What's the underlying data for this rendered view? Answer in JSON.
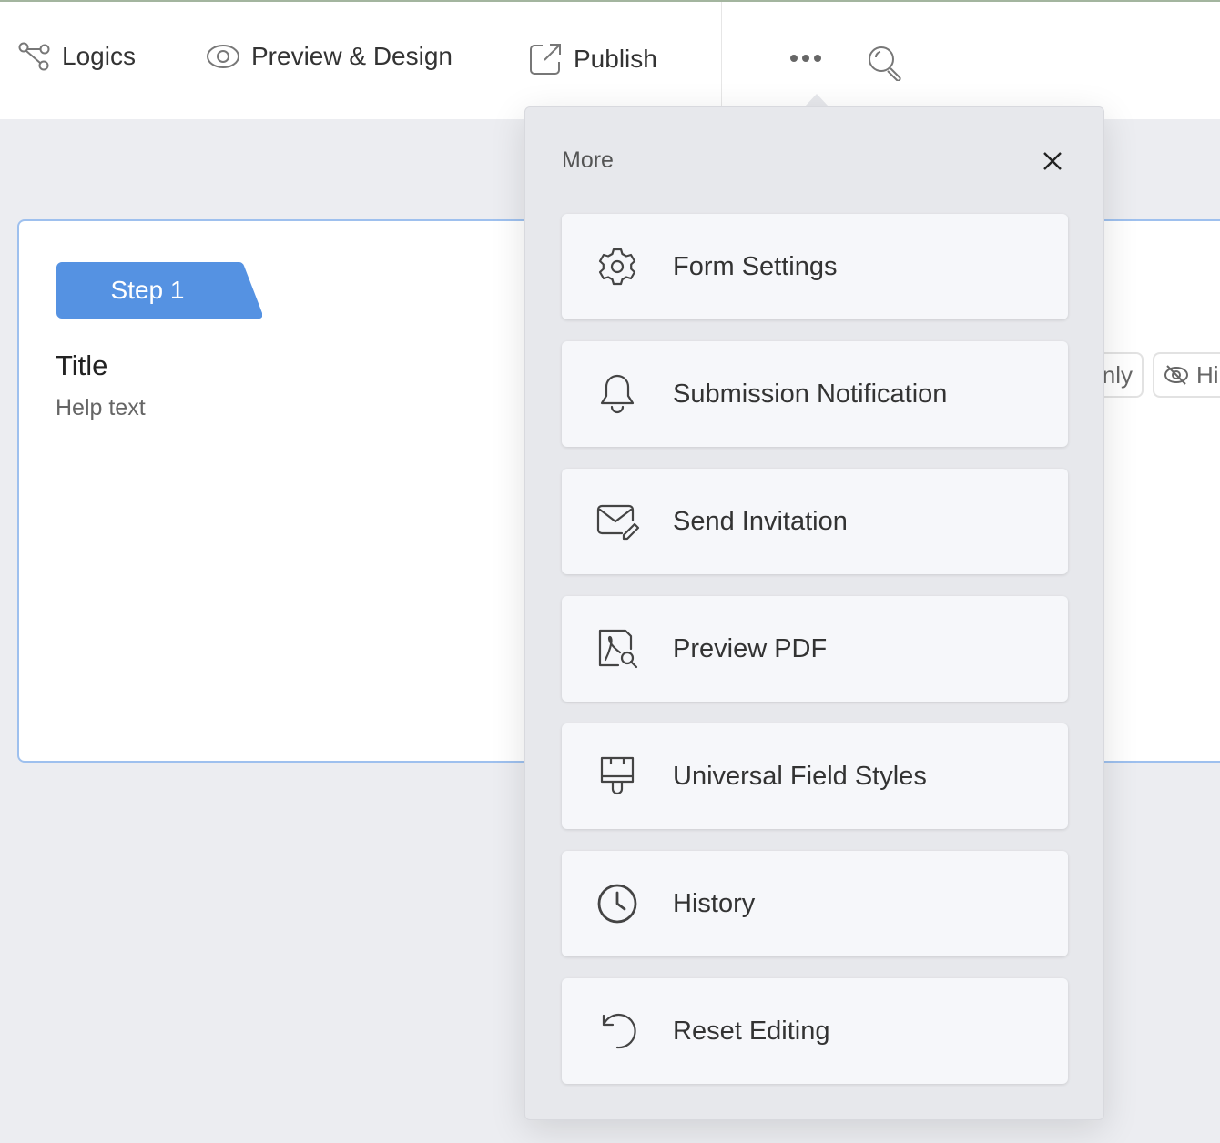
{
  "toolbar": {
    "logics": "Logics",
    "preview_design": "Preview & Design",
    "publish": "Publish"
  },
  "canvas": {
    "step": "Step 1",
    "title": "Title",
    "help": "Help text",
    "chip_readonly": "nly",
    "chip_hide": "Hi",
    "step_color": "#5592e2"
  },
  "more_menu": {
    "title": "More",
    "items": [
      {
        "label": "Form Settings",
        "icon": "gear-icon"
      },
      {
        "label": "Submission Notification",
        "icon": "bell-icon"
      },
      {
        "label": "Send Invitation",
        "icon": "mail-edit-icon"
      },
      {
        "label": "Preview PDF",
        "icon": "pdf-search-icon"
      },
      {
        "label": "Universal Field Styles",
        "icon": "brush-icon"
      },
      {
        "label": "History",
        "icon": "clock-icon"
      },
      {
        "label": "Reset Editing",
        "icon": "reset-icon"
      }
    ]
  }
}
